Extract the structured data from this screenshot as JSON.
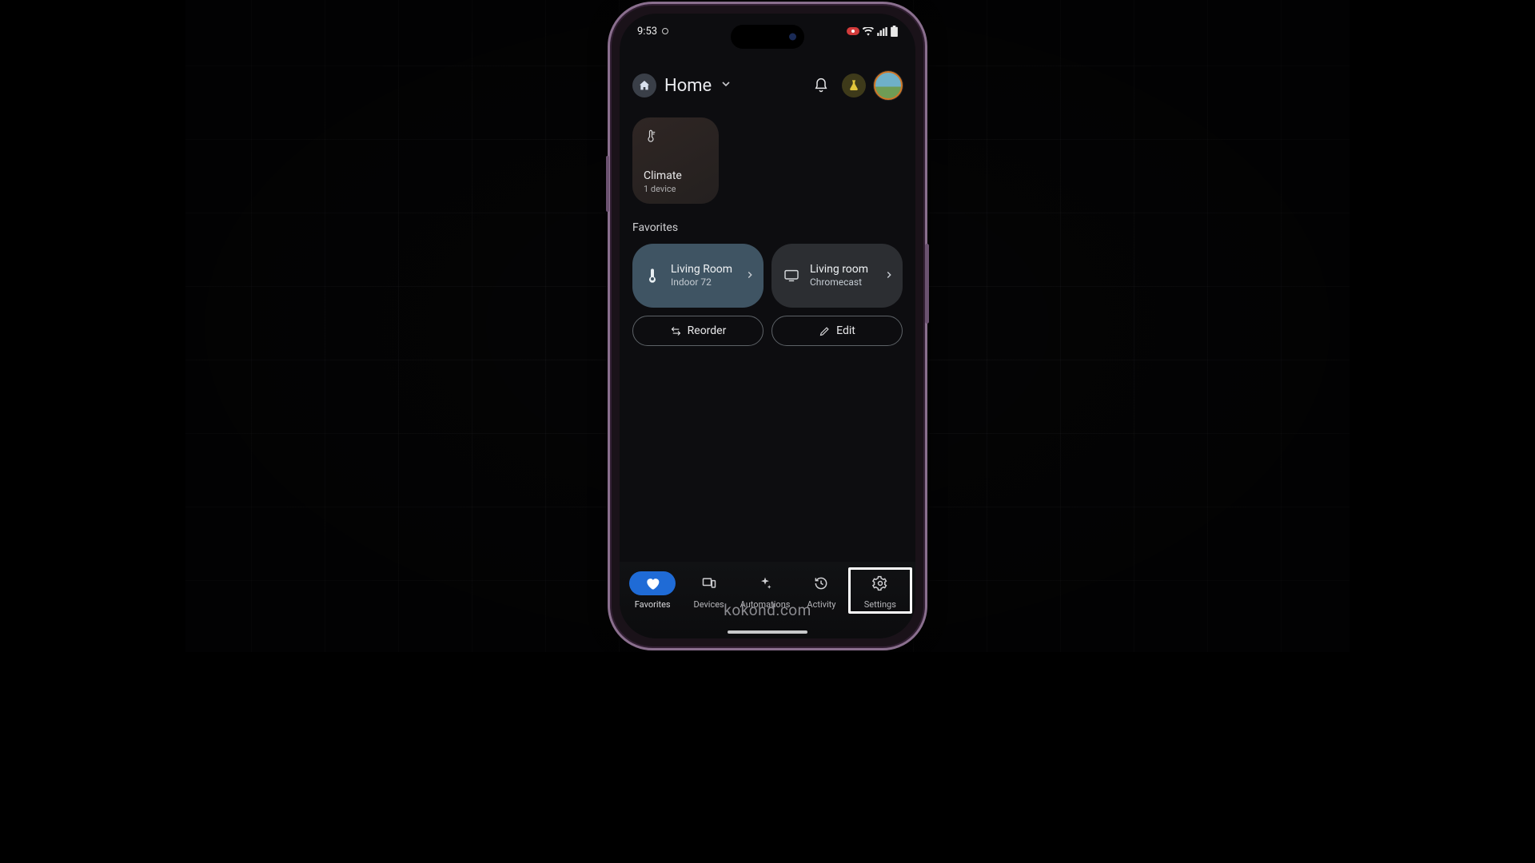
{
  "statusbar": {
    "time": "9:53"
  },
  "header": {
    "title": "Home"
  },
  "climate": {
    "title": "Climate",
    "subtitle": "1 device"
  },
  "sections": {
    "favorites_label": "Favorites"
  },
  "favorites": [
    {
      "title": "Living Room",
      "subtitle": "Indoor 72"
    },
    {
      "title": "Living room",
      "subtitle": "Chromecast"
    }
  ],
  "buttons": {
    "reorder": "Reorder",
    "edit": "Edit"
  },
  "nav": {
    "favorites": "Favorites",
    "devices": "Devices",
    "automations": "Automations",
    "activity": "Activity",
    "settings": "Settings"
  },
  "watermark": "kokond.com"
}
